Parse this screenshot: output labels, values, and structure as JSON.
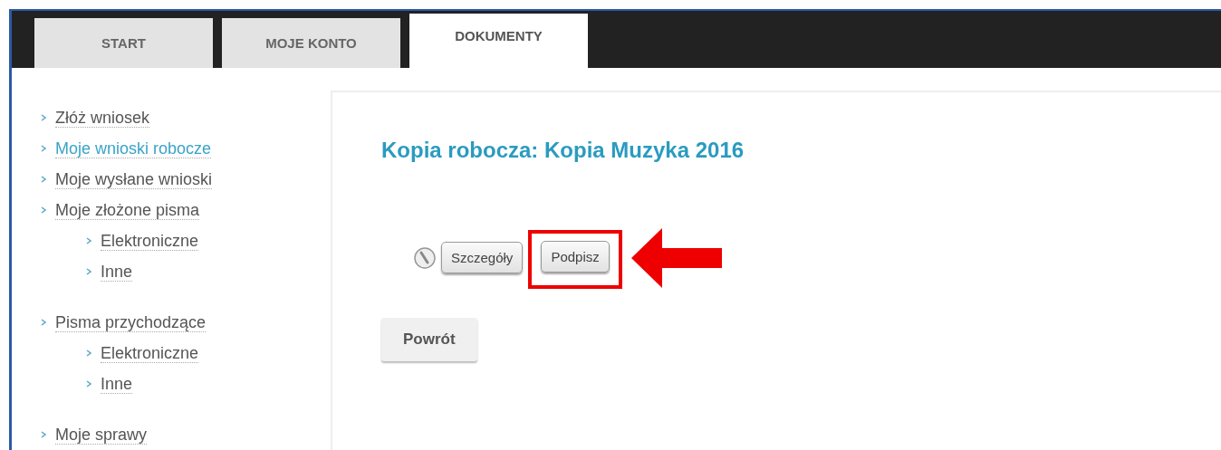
{
  "tabs": [
    {
      "label": "START",
      "selected": false
    },
    {
      "label": "MOJE KONTO",
      "selected": false
    },
    {
      "label": "DOKUMENTY",
      "selected": true
    }
  ],
  "sidebar": {
    "items": [
      {
        "label": "Złóż wniosek",
        "selected": false
      },
      {
        "label": "Moje wnioski robocze",
        "selected": true
      },
      {
        "label": "Moje wysłane wnioski",
        "selected": false
      },
      {
        "label": "Moje złożone pisma",
        "selected": false,
        "children": [
          {
            "label": "Elektroniczne",
            "selected": false
          },
          {
            "label": "Inne",
            "selected": false
          }
        ]
      },
      {
        "label": "Pisma przychodzące",
        "selected": false,
        "children": [
          {
            "label": "Elektroniczne",
            "selected": false
          },
          {
            "label": "Inne",
            "selected": false
          }
        ]
      },
      {
        "label": "Moje sprawy",
        "selected": false
      }
    ]
  },
  "content": {
    "title": "Kopia robocza: Kopia Muzyka 2016",
    "actions": [
      {
        "label": "Szczegóły",
        "highlighted": false
      },
      {
        "label": "Podpisz",
        "highlighted": true
      }
    ],
    "back_button": "Powrót"
  }
}
